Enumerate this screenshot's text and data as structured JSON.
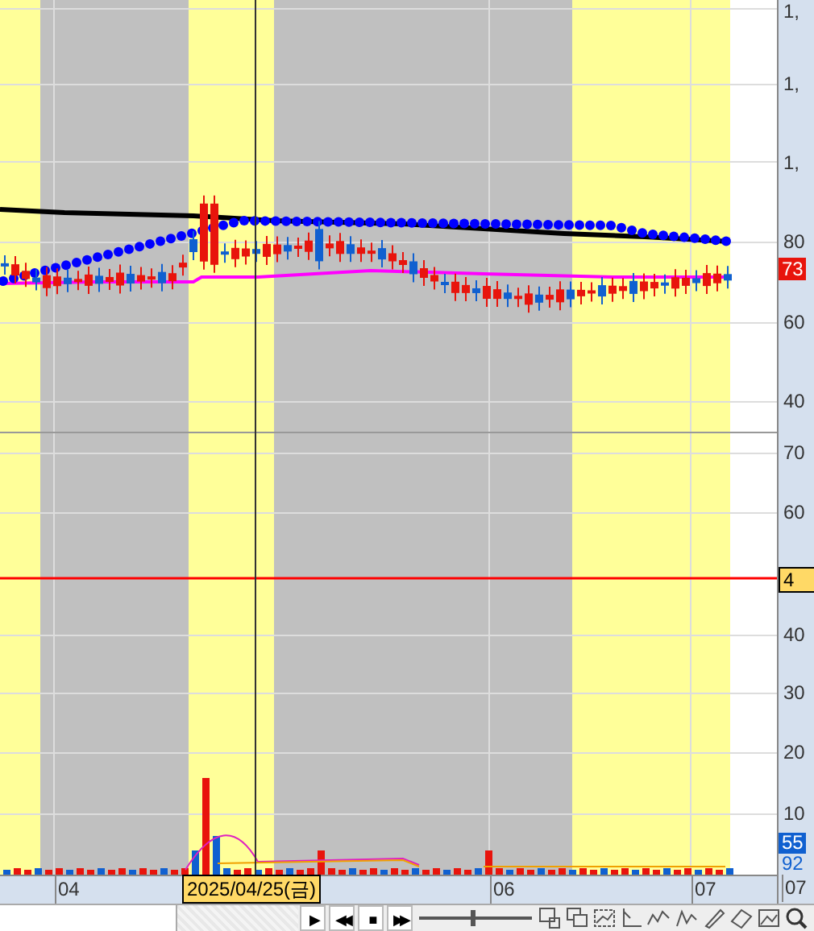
{
  "price_axis": {
    "labels": [
      "1,",
      "1,",
      "1,",
      "80",
      "60",
      "40"
    ],
    "current_price": "73"
  },
  "indicator_axis": {
    "labels": [
      "70",
      "60",
      "40",
      "30",
      "20",
      "10"
    ],
    "reference_value": "4",
    "volume_badge": "55",
    "volume_value": "92"
  },
  "time_axis": {
    "labels": [
      "04",
      "06",
      "07",
      "07"
    ],
    "cursor_date": "2025/04/25(금)"
  },
  "playback": {
    "buttons": [
      "▶",
      "◀◀",
      "■",
      "▶▶"
    ]
  },
  "zoom_slider": {
    "level": 0.48
  }
}
